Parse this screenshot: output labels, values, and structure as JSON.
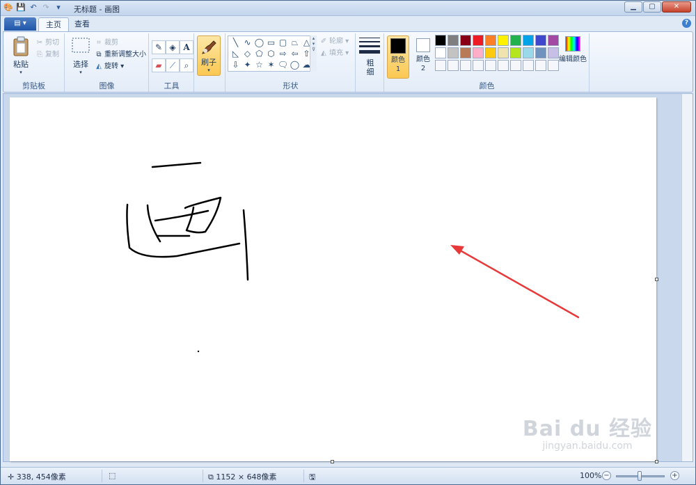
{
  "window": {
    "title": "无标题 - 画图",
    "controls": {
      "minimize": "▁",
      "maximize": "▢",
      "close": "✕"
    }
  },
  "qat": {
    "icons": [
      "paint-app-icon",
      "save-icon",
      "undo-icon",
      "redo-icon",
      "customize-dropdown-icon"
    ]
  },
  "tabs": {
    "app_menu": "▤ ▾",
    "home": "主页",
    "view": "查看"
  },
  "ribbon": {
    "clipboard": {
      "label": "剪贴板",
      "paste": "粘贴",
      "cut": "剪切",
      "copy": "复制"
    },
    "image": {
      "label": "图像",
      "select": "选择",
      "crop": "裁剪",
      "resize": "重新调整大小",
      "rotate": "旋转"
    },
    "tools": {
      "label": "工具"
    },
    "brushes": {
      "label": "刷子"
    },
    "shapes": {
      "label": "形状",
      "outline": "轮廓",
      "fill": "填充",
      "glyphs": [
        "╲",
        "∿",
        "◯",
        "▭",
        "▢",
        "⏢",
        "△",
        "◺",
        "◇",
        "⬠",
        "⬡",
        "⇨",
        "⇦",
        "⇧",
        "⇩",
        "✦",
        "☆",
        "✶",
        "🗨",
        "◯",
        "☁"
      ]
    },
    "size": {
      "label": "粗细"
    },
    "colors": {
      "label": "颜色",
      "color1_label": "颜色 1",
      "color2_label": "颜色 2",
      "color1_value": "#000000",
      "color2_value": "#ffffff",
      "edit_colors": "编辑颜色",
      "palette_row1": [
        "#000000",
        "#7f7f7f",
        "#880015",
        "#ed1c24",
        "#ff7f27",
        "#fff200",
        "#22b14c",
        "#00a2e8",
        "#3f48cc",
        "#a349a4"
      ],
      "palette_row2": [
        "#ffffff",
        "#c3c3c3",
        "#b97a57",
        "#ffaec9",
        "#ffc90e",
        "#efe4b0",
        "#b5e61d",
        "#99d9ea",
        "#7092be",
        "#c8bfe7"
      ],
      "palette_row3": [
        "#f5f7fa",
        "#f5f7fa",
        "#f5f7fa",
        "#f5f7fa",
        "#f5f7fa",
        "#f5f7fa",
        "#f5f7fa",
        "#f5f7fa",
        "#f5f7fa",
        "#f5f7fa"
      ]
    }
  },
  "canvas": {
    "drawing_character": "画",
    "arrow_color": "#e8393a",
    "watermark_line1": "Bai du 经验",
    "watermark_line2": "jingyan.baidu.com"
  },
  "status": {
    "cursor_pos": "338, 454像素",
    "canvas_size": "1152 × 648像素",
    "zoom": "100%"
  }
}
